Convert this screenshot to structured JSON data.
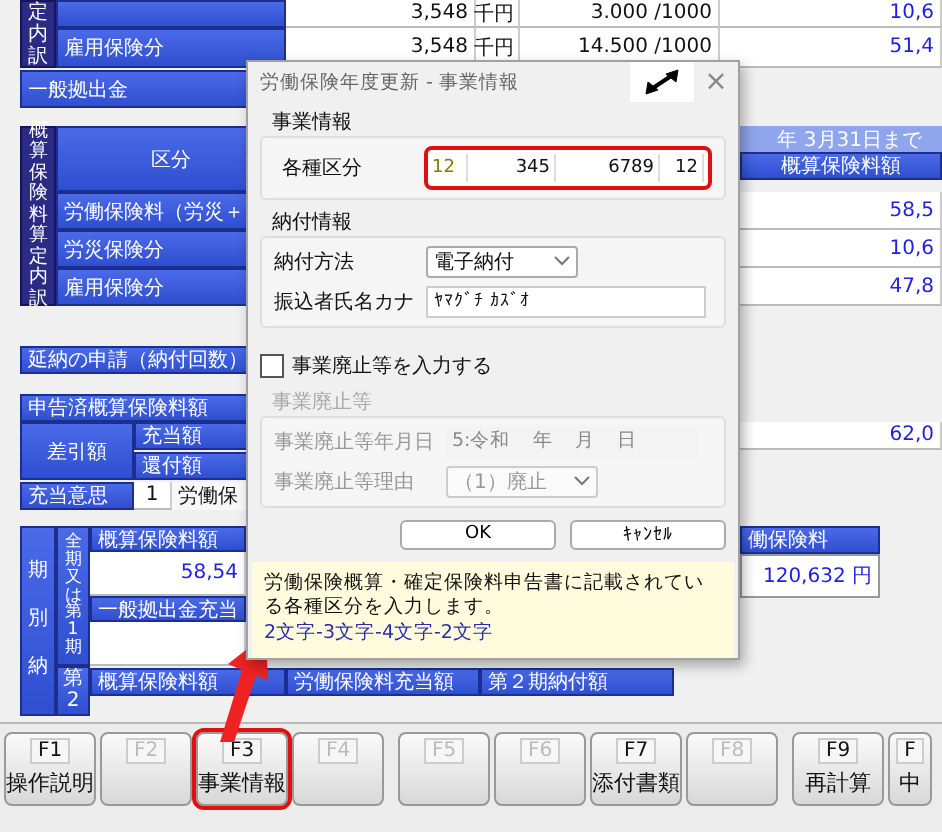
{
  "rate_breakdown": {
    "side_label": "定内訳",
    "rows": [
      {
        "amount": "3,548",
        "unit": "千円",
        "rate": "3.000 /1000",
        "premium": "10,6"
      },
      {
        "label": "雇用保険分",
        "amount": "3,548",
        "unit": "千円",
        "rate": "14.500 /1000",
        "premium": "51,4"
      }
    ]
  },
  "general_contribution_label": "一般拠出金",
  "estimate_section": {
    "side_label": "概算保険料算定内訳",
    "header": "区分",
    "period_header": "年 3月31日まで",
    "amount_header": "概算保険料額",
    "rows": [
      {
        "label": "労働保険料（労災＋",
        "amount": "58,5"
      },
      {
        "label": "労災保険分",
        "amount": "10,6"
      },
      {
        "label": "雇用保険分",
        "amount": "47,8"
      }
    ]
  },
  "deferral_label": "延納の申請（納付回数）",
  "declared_label": "申告済概算保険料額",
  "difference": {
    "label": "差引額",
    "allocation_label": "充当額",
    "refund_label": "還付額",
    "value": "62,0"
  },
  "allocation_intent": {
    "label": "充当意思",
    "code": "1",
    "text": "労働保"
  },
  "installments": {
    "side_label": "期別納",
    "first_period": {
      "label": "全期又は第1期",
      "estimate_header": "概算保険料額",
      "estimate_value": "58,54",
      "contribution_header": "一般拠出金充当"
    },
    "second_period": {
      "label": "第2",
      "headers": [
        "概算保険料額",
        "労働保険料充当額",
        "第２期納付額"
      ]
    },
    "total_header": "働保険料",
    "total_value": "120,632 円"
  },
  "function_keys": [
    {
      "key": "F1",
      "label": "操作説明",
      "disabled": false,
      "highlighted": false
    },
    {
      "key": "F2",
      "disabled": true,
      "highlighted": false
    },
    {
      "key": "F3",
      "label": "事業情報",
      "disabled": false,
      "highlighted": true
    },
    {
      "key": "F4",
      "disabled": true,
      "highlighted": false
    },
    {
      "key": "F5",
      "disabled": true,
      "highlighted": false
    },
    {
      "key": "F6",
      "disabled": true,
      "highlighted": false
    },
    {
      "key": "F7",
      "label": "添付書類",
      "disabled": false,
      "highlighted": false
    },
    {
      "key": "F8",
      "disabled": true,
      "highlighted": false
    },
    {
      "key": "F9",
      "label": "再計算",
      "disabled": false,
      "highlighted": false
    },
    {
      "key": "F",
      "label": "中",
      "disabled": false,
      "highlighted": false
    }
  ],
  "dialog": {
    "title": "労働保険年度更新 - 事業情報",
    "close": "×",
    "business_group": {
      "legend": "事業情報",
      "label": "各種区分",
      "highlighted": true,
      "fields": [
        "12",
        "345",
        "6789",
        "12"
      ]
    },
    "payment_group": {
      "legend": "納付情報",
      "method_label": "納付方法",
      "method_value": "電子納付",
      "name_label": "振込者氏名カナ",
      "name_value": "ﾔﾏｸﾞﾁ ｶｽﾞｵ"
    },
    "closure_toggle": {
      "label": "事業廃止等を入力する",
      "checked": false
    },
    "closure_group": {
      "legend": "事業廃止等",
      "disabled": true,
      "date_label": "事業廃止等年月日",
      "date_parts": [
        "5:令和",
        "年",
        "月",
        "日"
      ],
      "reason_label": "事業廃止等理由",
      "reason_value": "（1）廃止"
    },
    "buttons": [
      "OK",
      "ｷｬﾝｾﾙ"
    ],
    "help": {
      "text": "労働保険概算・確定保険料申告書に記載されている各種区分を入力します。",
      "format": "2文字-3文字-4文字-2文字"
    }
  }
}
